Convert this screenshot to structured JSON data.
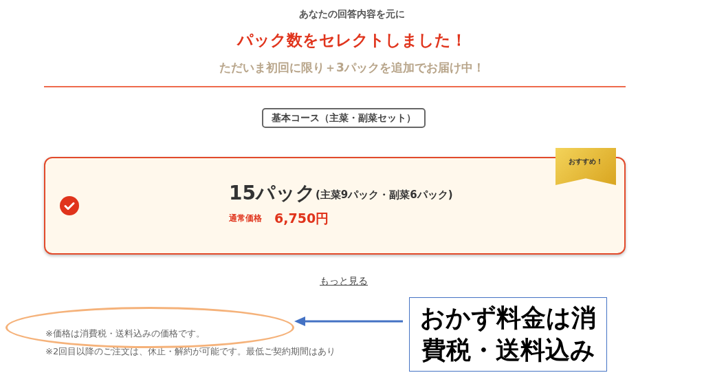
{
  "header": {
    "intro": "あなたの回答内容を元に",
    "title": "パック数をセレクトしました！",
    "subtitle": "ただいま初回に限り＋3パックを追加でお届け中！"
  },
  "course_tag": "基本コース（主菜・副菜セット）",
  "plan": {
    "selected": true,
    "badge": "おすすめ！",
    "packs": "15パック",
    "breakdown": "(主菜9パック・副菜6パック)",
    "price_label": "通常価格",
    "price": "6,750円"
  },
  "more_link": "もっと見る",
  "notes": [
    "※価格は消費税・送料込みの価格です。",
    "※2回目以降のご注文は、休止・解約が可能です。最低ご契約期間はあり"
  ],
  "annotation": {
    "callout": "おかず料金は消費税・送料込み"
  }
}
